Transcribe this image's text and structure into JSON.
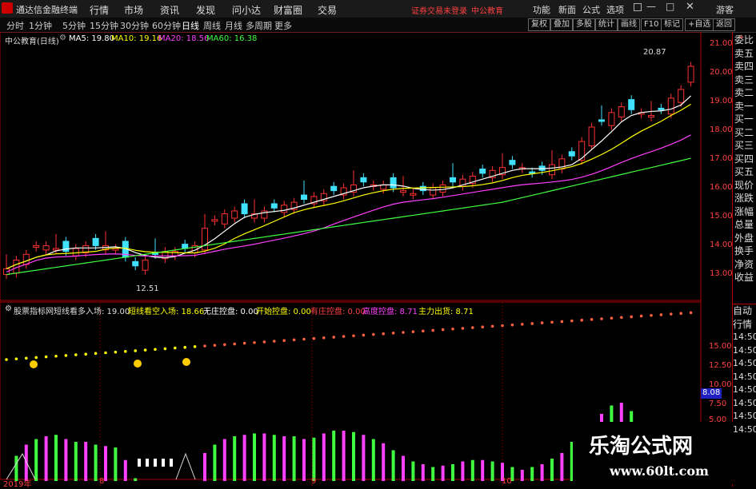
{
  "app": {
    "title": "通达信金融终端"
  },
  "menu": [
    "行情",
    "市场",
    "资讯",
    "发现",
    "问小达",
    "财富圈",
    "交易"
  ],
  "notice": {
    "login": "证券交易未登录",
    "account": "中公教育"
  },
  "system_buttons": [
    "功能",
    "新面",
    "公式",
    "选项",
    "游客"
  ],
  "periods": [
    "分时",
    "1分钟",
    "5分钟",
    "15分钟",
    "30分钟",
    "60分钟",
    "日线",
    "周线",
    "月线",
    "多周期",
    "更多"
  ],
  "active_period": "日线",
  "tools": [
    "复权",
    "叠加",
    "多股",
    "统计",
    "画线",
    "F10",
    "标记",
    "+自选",
    "返回"
  ],
  "stock": {
    "title": "中公教育(日线)"
  },
  "ma": [
    {
      "label": "MA5: 19.80",
      "color": "#ffffff"
    },
    {
      "label": "MA10: 19.16",
      "color": "#ffff00"
    },
    {
      "label": "MA20: 18.56",
      "color": "#ff40ff"
    },
    {
      "label": "MA60: 16.38",
      "color": "#40ff40"
    }
  ],
  "price_axis": [
    "21.00",
    "20.00",
    "19.00",
    "18.00",
    "17.00",
    "16.00",
    "15.00",
    "14.00",
    "13.00"
  ],
  "annotations": {
    "high": "20.87",
    "low": "12.51"
  },
  "indicator": {
    "name": "股票指标网",
    "values": [
      {
        "label": "短线看多入场: 19.00",
        "color": "#dddddd"
      },
      {
        "label": "短线看空入场: 18.66",
        "color": "#ffff00"
      },
      {
        "label": "无庄控盘: 0.00",
        "color": "#ffffff"
      },
      {
        "label": "开始控盘: 0.00",
        "color": "#ffff00"
      },
      {
        "label": "有庄控盘: 0.00",
        "color": "#ff4040"
      },
      {
        "label": "高度控盘: 8.71",
        "color": "#ff40ff"
      },
      {
        "label": "主力出货: 8.71",
        "color": "#ffff00"
      }
    ]
  },
  "ind_axis": [
    "15.00",
    "12.50",
    "10.00",
    "7.50",
    "5.00"
  ],
  "ind_value": "8.08",
  "bottom_axis": {
    "year": "2019年",
    "m8": "8",
    "m9": "9",
    "m10": "10"
  },
  "right_panel": {
    "quote": [
      "委比",
      "卖五",
      "卖四",
      "卖三",
      "卖二",
      "卖一",
      "买一",
      "买二",
      "买三",
      "买四",
      "买五",
      "现价",
      "涨跌",
      "涨幅",
      "总量",
      "外盘",
      "换手",
      "净资",
      "收益"
    ],
    "tabs": [
      "自动",
      "行情"
    ],
    "times": [
      "14:50",
      "14:50",
      "14:50",
      "14:50",
      "14:50",
      "14:50",
      "14:50",
      "14:50"
    ]
  },
  "watermark": {
    "cn": "乐淘公式网",
    "url": "www.60lt.com"
  }
}
